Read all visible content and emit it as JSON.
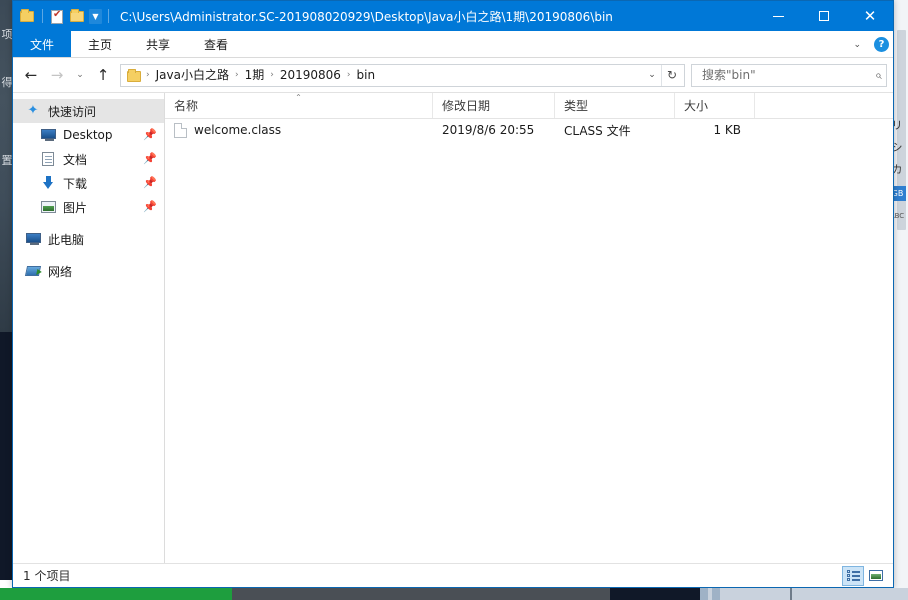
{
  "window": {
    "title": "C:\\Users\\Administrator.SC-201908020929\\Desktop\\Java小白之路\\1期\\20190806\\bin",
    "quick_access_toolbar": [
      {
        "name": "folder-icon",
        "label": ""
      },
      {
        "name": "properties-icon",
        "label": ""
      },
      {
        "name": "new-folder-icon",
        "label": ""
      },
      {
        "name": "customize-chevron-icon",
        "label": "▼"
      }
    ],
    "controls": {
      "minimize": "Minimize",
      "maximize": "Maximize",
      "close": "✕"
    }
  },
  "ribbon": {
    "tabs": [
      {
        "label": "文件",
        "active": true
      },
      {
        "label": "主页",
        "active": false
      },
      {
        "label": "共享",
        "active": false
      },
      {
        "label": "查看",
        "active": false
      }
    ],
    "expand_chevron": "⌄",
    "help_label": "?"
  },
  "navigation": {
    "back": "←",
    "forward": "→",
    "recent": "⌄",
    "up": "↑",
    "breadcrumb": [
      "Java小白之路",
      "1期",
      "20190806",
      "bin"
    ],
    "breadcrumb_separator": "›",
    "dropdown": "⌄",
    "refresh": "↻"
  },
  "search": {
    "placeholder": "搜索\"bin\"",
    "value": "",
    "icon": "⌕"
  },
  "sidebar": {
    "items": [
      {
        "label": "快速访问",
        "icon": "star-icon",
        "selected": true,
        "indent": false,
        "pinned": false
      },
      {
        "label": "Desktop",
        "icon": "monitor-icon",
        "selected": false,
        "indent": true,
        "pinned": true
      },
      {
        "label": "文档",
        "icon": "document-icon",
        "selected": false,
        "indent": true,
        "pinned": true
      },
      {
        "label": "下载",
        "icon": "download-icon",
        "selected": false,
        "indent": true,
        "pinned": true
      },
      {
        "label": "图片",
        "icon": "picture-icon",
        "selected": false,
        "indent": true,
        "pinned": true
      },
      {
        "label": "此电脑",
        "icon": "computer-icon",
        "selected": false,
        "indent": false,
        "pinned": false
      },
      {
        "label": "网络",
        "icon": "network-icon",
        "selected": false,
        "indent": false,
        "pinned": false
      }
    ],
    "pin_glyph": "📌"
  },
  "file_list": {
    "columns": [
      {
        "label": "名称",
        "sorted": true,
        "sort_caret": "⌃"
      },
      {
        "label": "修改日期",
        "sorted": false,
        "sort_caret": ""
      },
      {
        "label": "类型",
        "sorted": false,
        "sort_caret": ""
      },
      {
        "label": "大小",
        "sorted": false,
        "sort_caret": ""
      }
    ],
    "rows": [
      {
        "name": "welcome.class",
        "date_modified": "2019/8/6 20:55",
        "type": "CLASS 文件",
        "size": "1 KB"
      }
    ]
  },
  "status_bar": {
    "item_count": "1 个项目",
    "views": [
      {
        "name": "details-view-button",
        "active": true
      },
      {
        "name": "large-icons-view-button",
        "active": false
      }
    ]
  },
  "background": {
    "left_glyphs": [
      "项",
      "得",
      "置"
    ],
    "right_glyphs": [
      "リ",
      "シ",
      "カ"
    ],
    "right_badge": "GB",
    "right_tiny": "ABC"
  },
  "colors": {
    "accent": "#0078d7",
    "title_bar": "#0078d7",
    "selection": "#e5e5e5",
    "hover": "#e8f3fc",
    "folder": "#f5cf62",
    "progress": "#1e9e3e"
  }
}
